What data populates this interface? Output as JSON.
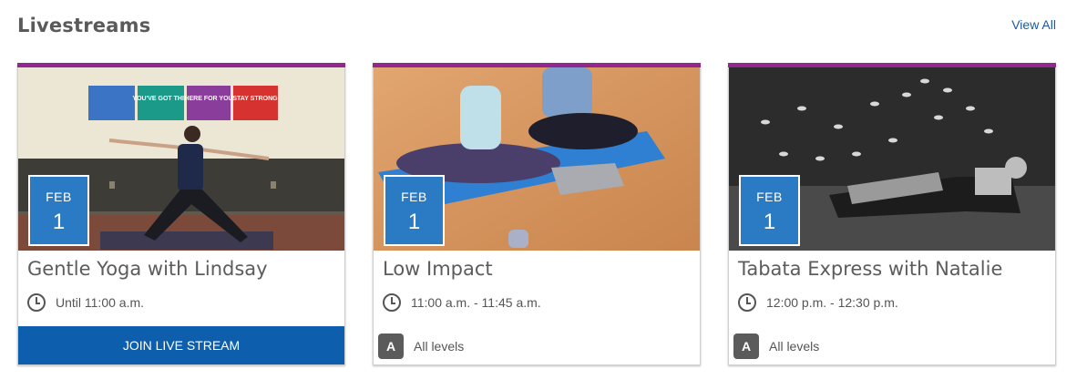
{
  "section": {
    "title": "Livestreams",
    "view_all_label": "View All"
  },
  "colors": {
    "accent_bar": "#92278f",
    "date_badge": "#2a7bc4",
    "join_button": "#0d5fae",
    "level_badge": "#5b5b5b"
  },
  "cards": [
    {
      "image": "yoga-warrior-pose-photo",
      "date_month": "FEB",
      "date_day": "1",
      "title": "Gentle Yoga with Lindsay",
      "time": "Until 11:00 a.m.",
      "join_label": "JOIN LIVE STREAM",
      "poster_texts": [
        "YOU'VE GOT THIS",
        "HERE FOR YOU",
        "STAY STRONG"
      ]
    },
    {
      "image": "two-people-stretching-photo",
      "date_month": "FEB",
      "date_day": "1",
      "title": "Low Impact",
      "time": "11:00 a.m. - 11:45 a.m.",
      "level_badge": "A",
      "level_text": "All levels"
    },
    {
      "image": "plank-pose-bw-photo",
      "date_month": "FEB",
      "date_day": "1",
      "title": "Tabata Express with Natalie",
      "time": "12:00 p.m. - 12:30 p.m.",
      "level_badge": "A",
      "level_text": "All levels"
    }
  ]
}
